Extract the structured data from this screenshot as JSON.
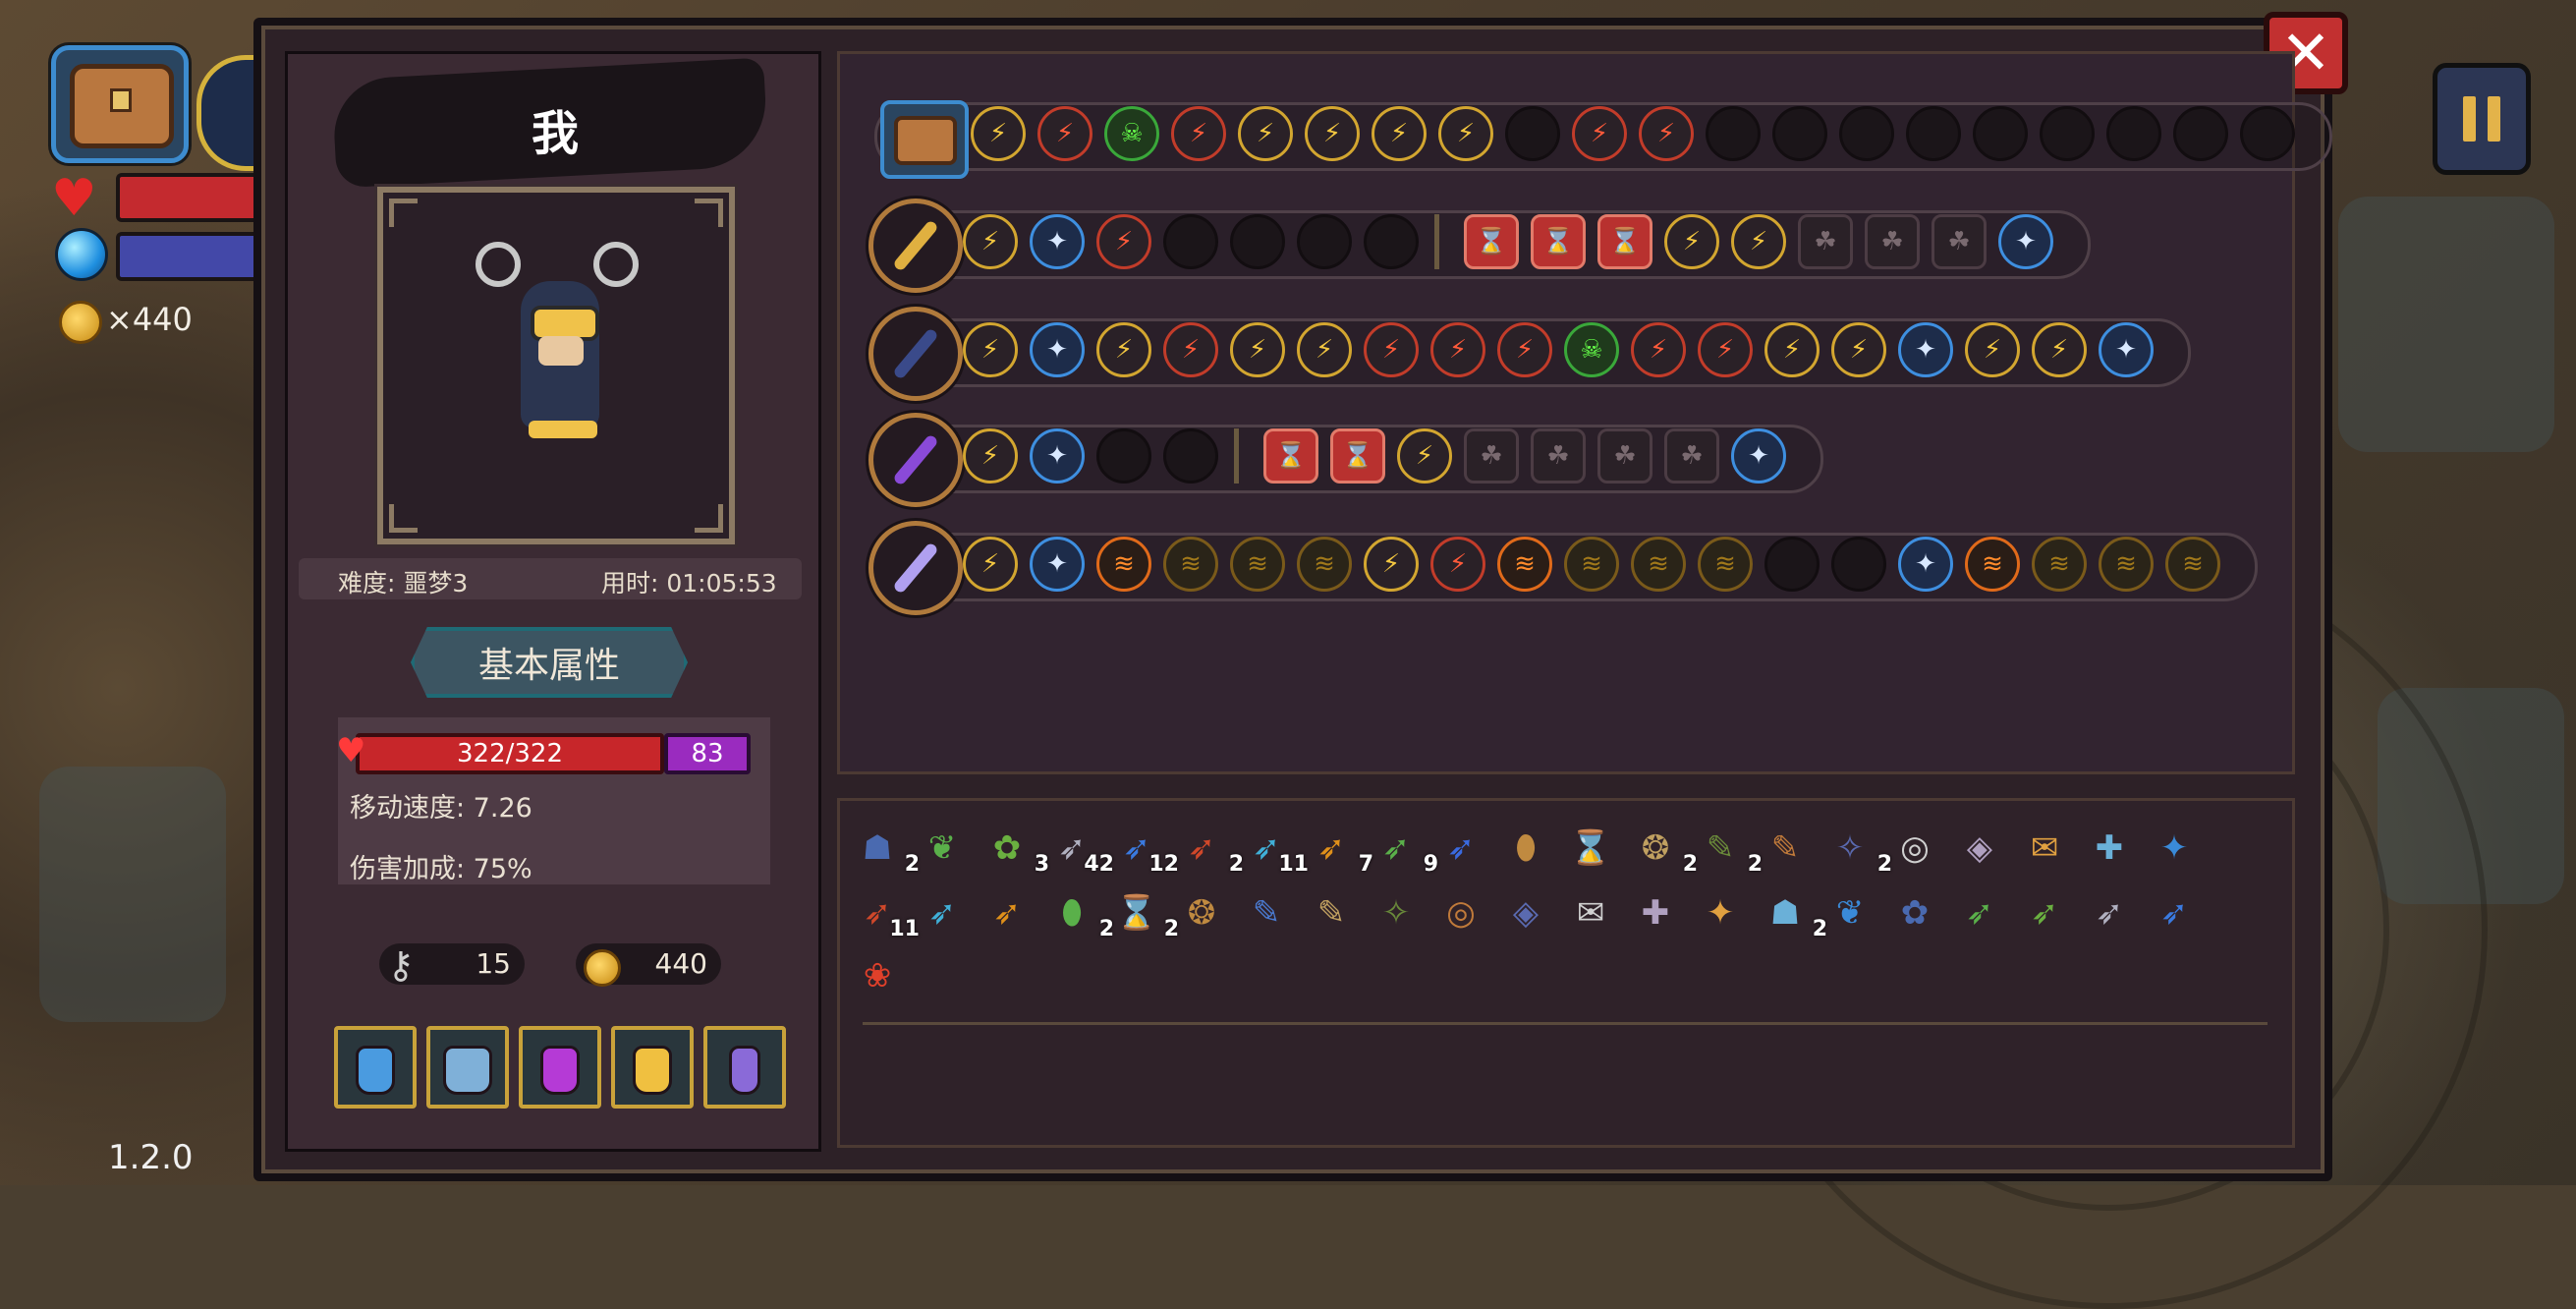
{
  "hud": {
    "coin_count": "×440",
    "version": "1.2.0"
  },
  "character": {
    "name": "我",
    "difficulty": "难度: 噩梦3",
    "time": "用时: 01:05:53",
    "tab_label": "基本属性",
    "hp": "322/322",
    "mp": "83",
    "move_speed": "移动速度: 7.26",
    "damage_bonus": "伤害加成: 75%",
    "keys": "15",
    "gold": "440"
  },
  "colors": {
    "panel_bg": "#2d2127",
    "gold_border": "#d3a630",
    "blue_border": "#3e8fe0",
    "hp_red": "#c7262a",
    "mp_purple": "#9a2bbf"
  },
  "equipment_rows": [
    {
      "weapon": "chest",
      "slots": [
        "gold",
        "redc",
        "green",
        "redc",
        "gold",
        "gold",
        "gold",
        "gold",
        "empty",
        "redc",
        "redc",
        "empty",
        "empty",
        "empty",
        "empty",
        "empty",
        "empty",
        "empty",
        "empty",
        "empty"
      ]
    },
    {
      "weapon": "staff-gold",
      "slots": [
        "gold",
        "blue",
        "redc",
        "empty",
        "empty",
        "empty",
        "empty",
        "|",
        "red",
        "red",
        "red",
        "gold",
        "gold",
        "dark",
        "dark",
        "dark",
        "blue"
      ]
    },
    {
      "weapon": "spellbook",
      "slots": [
        "gold",
        "blue",
        "gold",
        "redc",
        "gold",
        "gold",
        "redc",
        "redc",
        "redc",
        "green",
        "redc",
        "redc",
        "gold",
        "gold",
        "blue",
        "gold",
        "gold",
        "blue"
      ]
    },
    {
      "weapon": "purple-wand",
      "slots": [
        "gold",
        "blue",
        "empty",
        "empty",
        "|",
        "red",
        "red",
        "gold",
        "dark",
        "dark",
        "dark",
        "dark",
        "blue"
      ]
    },
    {
      "weapon": "star-wand",
      "slots": [
        "gold",
        "blue",
        "orange",
        "olive",
        "olive",
        "olive",
        "gold",
        "redc",
        "orange",
        "olive",
        "olive",
        "olive",
        "empty",
        "empty",
        "blue",
        "orange",
        "olive",
        "olive",
        "olive"
      ]
    }
  ],
  "inventory_counts": [
    "2",
    "3",
    "42",
    "12",
    "2",
    "11",
    "7",
    "9",
    "2",
    "2",
    "2",
    "11",
    "2",
    "2",
    "2"
  ]
}
